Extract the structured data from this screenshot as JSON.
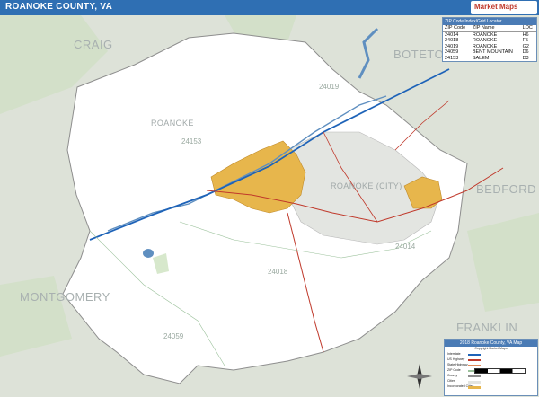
{
  "title": "ROANOKE COUNTY, VA",
  "neighbors": [
    "CRAIG",
    "BOTETOURT",
    "BEDFORD",
    "FRANKLIN",
    "MONTGOMERY"
  ],
  "places": [
    "ROANOKE",
    "ROANOKE (CITY)"
  ],
  "zip_labels": [
    "24019",
    "24153",
    "24018",
    "24014",
    "24059"
  ],
  "zip_table": {
    "heading": "ZIP Code Index/Grid Locator",
    "columns": [
      "ZIP Code",
      "ZIP Name",
      "LOC"
    ],
    "rows": [
      [
        "24014",
        "ROANOKE",
        "H6"
      ],
      [
        "24018",
        "ROANOKE",
        "F5"
      ],
      [
        "24019",
        "ROANOKE",
        "G2"
      ],
      [
        "24059",
        "BENT MOUNTAIN",
        "D6"
      ],
      [
        "24153",
        "SALEM",
        "D3"
      ]
    ]
  },
  "legend": {
    "title": "2018 Roanoke County, VA Map",
    "subtitle": "Copyright Market Maps",
    "items": [
      "Interstate",
      "US Highway",
      "State Highway",
      "ZIP Code",
      "County",
      "Cities",
      "Incorporated Cities"
    ]
  },
  "logo_text": "Market Maps",
  "colors": {
    "title_bar": "#2f6fb3",
    "county_fill": "#ffffff",
    "outside_fill": "#dde2d8",
    "city_fill": "#e7b64c",
    "water": "#5f8fc0",
    "park": "#d7e8cc"
  }
}
